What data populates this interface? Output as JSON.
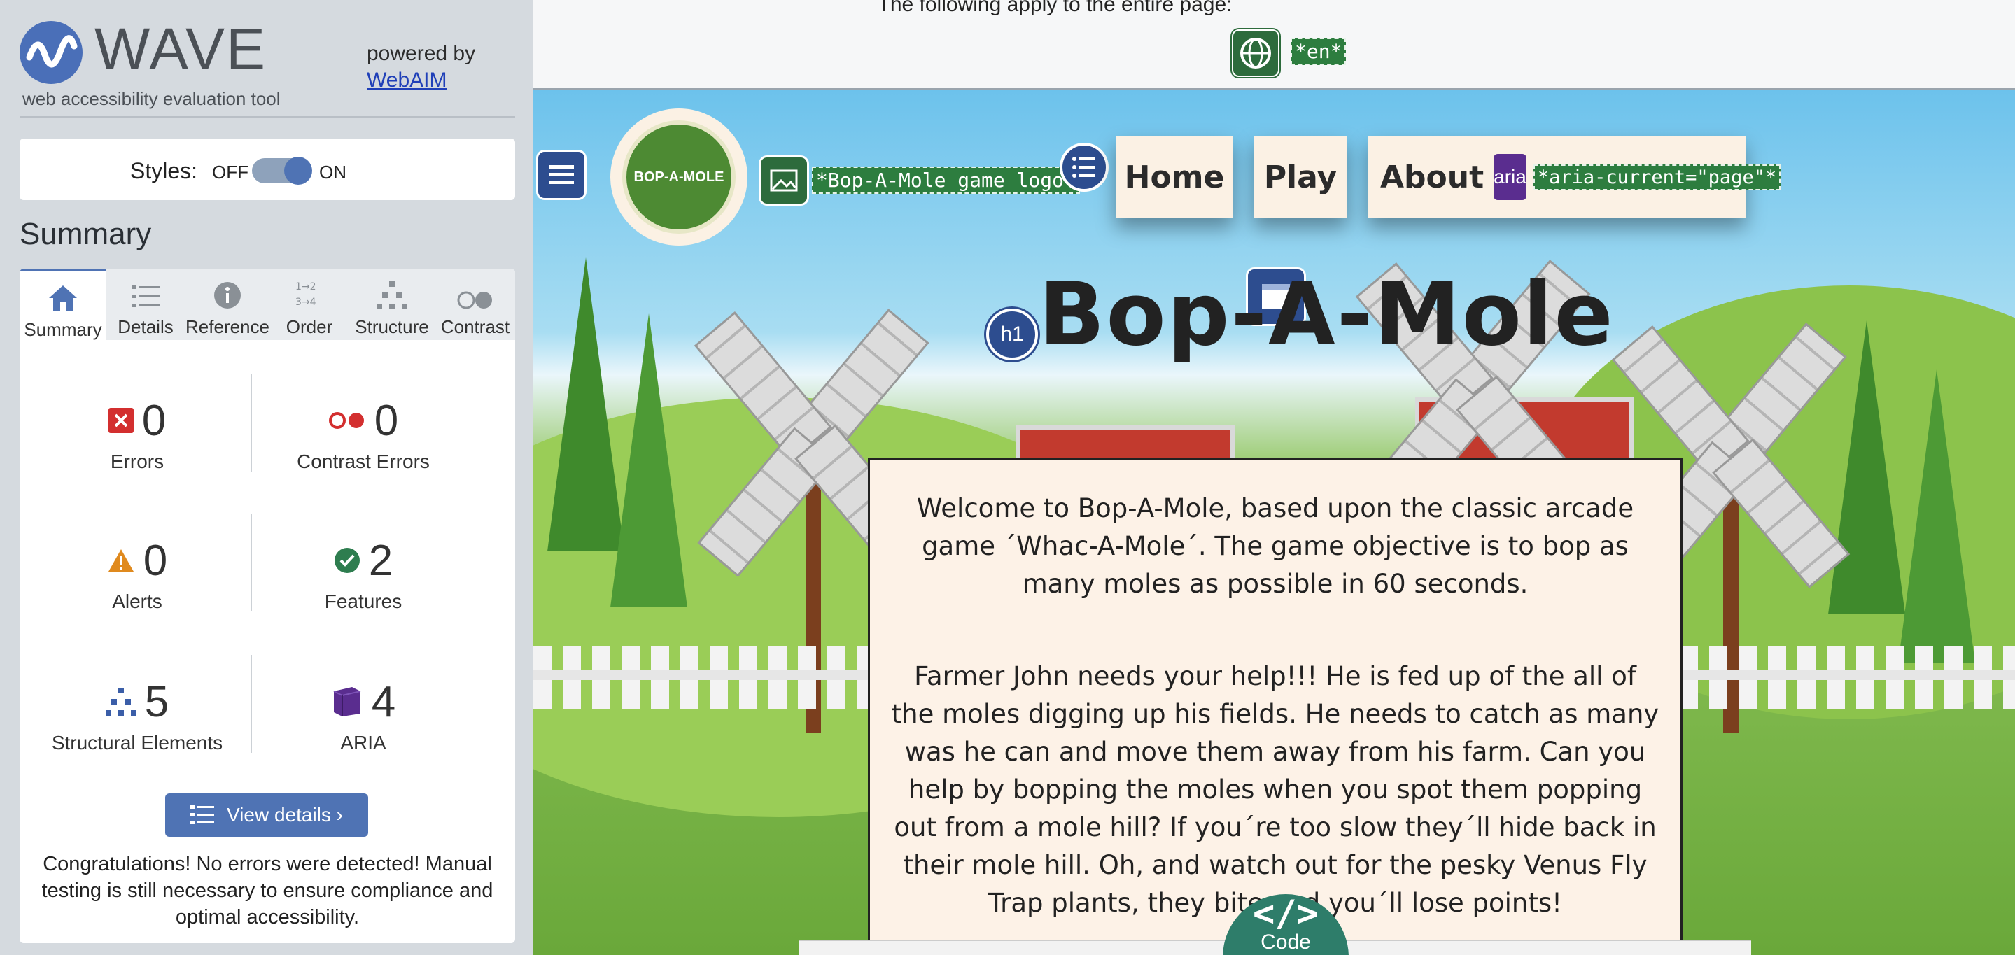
{
  "wave": {
    "title": "WAVE",
    "subtitle": "web accessibility evaluation tool",
    "powered_by": "powered by",
    "webaim_link": "WebAIM",
    "styles_label": "Styles:",
    "toggle_off": "OFF",
    "toggle_on": "ON",
    "summary_heading": "Summary",
    "tabs": [
      {
        "label": "Summary",
        "icon": "home-icon",
        "active": true
      },
      {
        "label": "Details",
        "icon": "list-icon"
      },
      {
        "label": "Reference",
        "icon": "info-icon"
      },
      {
        "label": "Order",
        "icon": "order-icon"
      },
      {
        "label": "Structure",
        "icon": "structure-icon"
      },
      {
        "label": "Contrast",
        "icon": "contrast-icon"
      }
    ],
    "stats": [
      {
        "count": "0",
        "label": "Errors",
        "icon": "error-icon",
        "color": "#d32f2f"
      },
      {
        "count": "0",
        "label": "Contrast Errors",
        "icon": "contrast-error-icon",
        "color": "#d32f2f"
      },
      {
        "count": "0",
        "label": "Alerts",
        "icon": "alert-icon",
        "color": "#e08a1e"
      },
      {
        "count": "2",
        "label": "Features",
        "icon": "feature-icon",
        "color": "#2e7d4f"
      },
      {
        "count": "5",
        "label": "Structural Elements",
        "icon": "structure-icon",
        "color": "#3b5ea8"
      },
      {
        "count": "4",
        "label": "ARIA",
        "icon": "aria-icon",
        "color": "#5a2d8f"
      }
    ],
    "view_details": "View details ›",
    "congrats": "Congratulations! No errors were detected! Manual testing is still necessary to ensure compliance and optimal accessibility.",
    "accent": "#4f73b4"
  },
  "page": {
    "top_notice": "The following apply to the entire page:",
    "lang_tag": "*en*",
    "logo_alt_tag": "*Bop-A-Mole game logo*",
    "logo_text": "BOP-A-MOLE",
    "nav": [
      "Home",
      "Play",
      "About"
    ],
    "aria_badge": "aria",
    "aria_current_tag": "*aria-current=\"page\"*",
    "h1_badge": "h1",
    "heading": "Bop-A-Mole",
    "para1": "Welcome to Bop-A-Mole, based upon the classic arcade game ´Whac-A-Mole´. The game objective is to bop as many moles as possible in 60 seconds.",
    "para2": "Farmer John needs your help!!! He is fed up of the all of the moles digging up his fields. He needs to catch as many was he can and move them away from his farm. Can you help by bopping the moles when you spot them popping out from a mole hill? If you´re too slow they´ll hide back in their mole hill. Oh, and watch out for the pesky Venus Fly Trap plants, they bite and you´ll lose points!",
    "code_label": "Code",
    "code_glyph": "</>"
  }
}
